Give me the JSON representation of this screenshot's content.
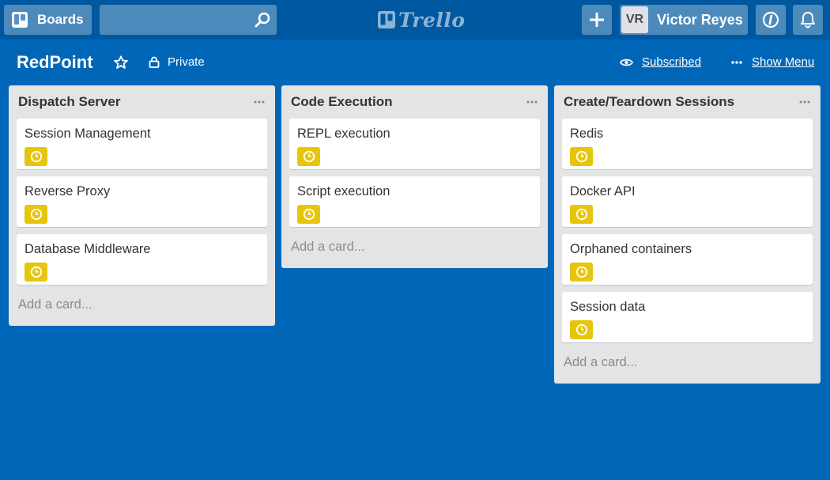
{
  "header": {
    "boards_label": "Boards",
    "search_value": "",
    "logo_text": "Trello",
    "add_icon": "plus-icon",
    "user_initials": "VR",
    "user_name": "Victor Reyes"
  },
  "board": {
    "title": "RedPoint",
    "visibility": "Private",
    "subscribed_label": "Subscribed",
    "show_menu_label": "Show Menu"
  },
  "colors": {
    "background": "#0067b8",
    "header": "#0058a0",
    "list": "#e2e4e6",
    "due_badge": "#e6c60d"
  },
  "lists": [
    {
      "title": "Dispatch Server",
      "cards": [
        "Session Management",
        "Reverse Proxy",
        "Database Middleware"
      ],
      "add_card": "Add a card..."
    },
    {
      "title": "Code Execution",
      "cards": [
        "REPL execution",
        "Script execution"
      ],
      "add_card": "Add a card..."
    },
    {
      "title": "Create/Teardown Sessions",
      "cards": [
        "Redis",
        "Docker API",
        "Orphaned containers",
        "Session data"
      ],
      "add_card": "Add a card..."
    }
  ]
}
